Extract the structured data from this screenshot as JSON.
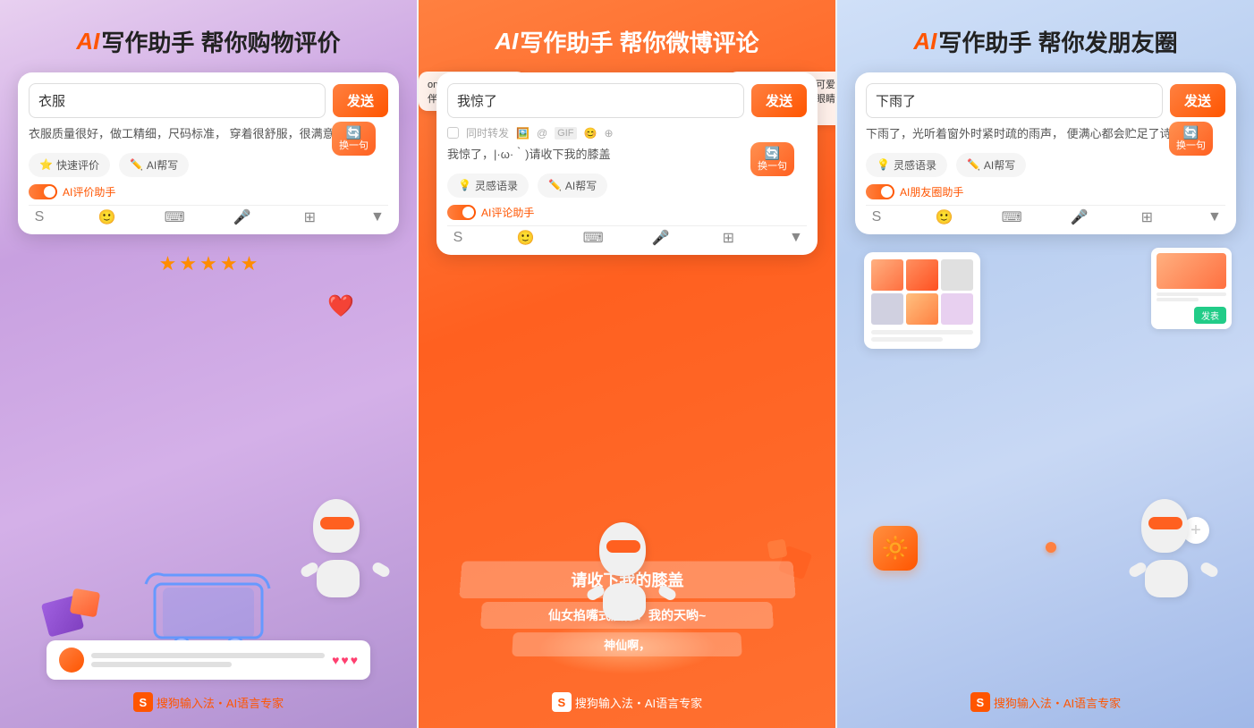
{
  "panels": [
    {
      "id": "panel-1",
      "bg": "purple",
      "title_prefix": "AI",
      "title_main": "写作助手 帮你购物评价",
      "input_value": "衣服",
      "send_label": "发送",
      "reply_text": "衣服质量很好，做工精细，尺码标准，\n穿着很舒服，很满意。",
      "huan_label": "换一句",
      "quick_btn_1": "快速评价",
      "quick_btn_2": "AI帮写",
      "toggle_label": "AI评价助手",
      "stars": "★★★★★",
      "footer_brand": "搜狗输入法・AI语言专家"
    },
    {
      "id": "panel-2",
      "bg": "orange",
      "title_prefix": "AI",
      "title_main": "写作助手 帮你微博评论",
      "input_value": "我惊了",
      "send_label": "发送",
      "weibo_label": "同时转发",
      "reply_text": "我惊了，|·ω·｀)请收下我的膝盖",
      "huan_label": "换一句",
      "quick_btn_1": "灵感语录",
      "quick_btn_2": "AI帮写",
      "toggle_label": "AI评论助手",
      "ribbon_1": "请收下我的膝盖",
      "ribbon_2": "仙女掐嘴式震惊！我的天哟~",
      "ribbon_3": "神仙啊，",
      "comment_left": "omg！我和我的小伙伴都惊呆了",
      "comment_right": "这不是真的，本小可爱已经不相信我的大眼睛了",
      "footer_brand": "搜狗输入法・AI语言专家"
    },
    {
      "id": "panel-3",
      "bg": "blue",
      "title_prefix": "AI",
      "title_main": "写作助手 帮你发朋友圈",
      "input_value": "下雨了",
      "send_label": "发送",
      "reply_text": "下雨了，光听着窗外时紧时疏的雨声，\n便满心都会贮足了诗",
      "huan_label": "换一句",
      "quick_btn_1": "灵感语录",
      "quick_btn_2": "AI帮写",
      "toggle_label": "AI朋友圈助手",
      "footer_brand": "搜狗输入法・AI语言专家"
    }
  ]
}
